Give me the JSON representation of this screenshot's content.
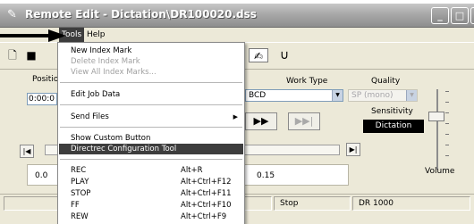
{
  "window": {
    "title": "Remote Edit - Dictation\\DR100020.dss",
    "title_icon": "pen-icon"
  },
  "menubar": {
    "tools_label": "Tools",
    "help_label": "Help"
  },
  "toolbar": {
    "icons": [
      "new-document-icon",
      "save-icon",
      "pen-tool-icon",
      "undo-icon"
    ]
  },
  "main": {
    "position_label": "Positio",
    "position_value": "0:00:0",
    "work_type_label": "Work Type",
    "work_type_value": "BCD",
    "quality_label": "Quality",
    "quality_value": "SP (mono)",
    "sensitivity_label": "Sensitivity",
    "sensitivity_value": "Dictation",
    "volume_label": "Volume",
    "ruler_left_label": "0.0",
    "ruler_right_label": "0.15"
  },
  "statusbar": {
    "status": "Stop",
    "device": "DR 1000"
  },
  "tools_menu": {
    "items": [
      {
        "label": "New Index Mark",
        "shortcut": "",
        "disabled": false
      },
      {
        "label": "Delete Index Mark",
        "shortcut": "",
        "disabled": true
      },
      {
        "label": "View All Index Marks...",
        "shortcut": "",
        "disabled": true
      },
      {
        "label": "Edit Job Data",
        "shortcut": "",
        "disabled": false
      },
      {
        "label": "Send Files",
        "shortcut": "",
        "disabled": false,
        "submenu": true
      },
      {
        "label": "Show Custom Button",
        "shortcut": "",
        "disabled": false
      },
      {
        "label": "Directrec Configuration Tool",
        "shortcut": "",
        "disabled": false,
        "highlighted": true
      },
      {
        "label": "REC",
        "shortcut": "Alt+R",
        "disabled": false
      },
      {
        "label": "PLAY",
        "shortcut": "Alt+Ctrl+F12",
        "disabled": false
      },
      {
        "label": "STOP",
        "shortcut": "Alt+Ctrl+F11",
        "disabled": false
      },
      {
        "label": "FF",
        "shortcut": "Alt+Ctrl+F10",
        "disabled": false
      },
      {
        "label": "REW",
        "shortcut": "Alt+Ctrl+F9",
        "disabled": false
      }
    ]
  },
  "colors": {
    "menu_highlight": "#3d3d3d",
    "titlebar": "#a0a0a0",
    "window_bg": "#ece9d8"
  }
}
